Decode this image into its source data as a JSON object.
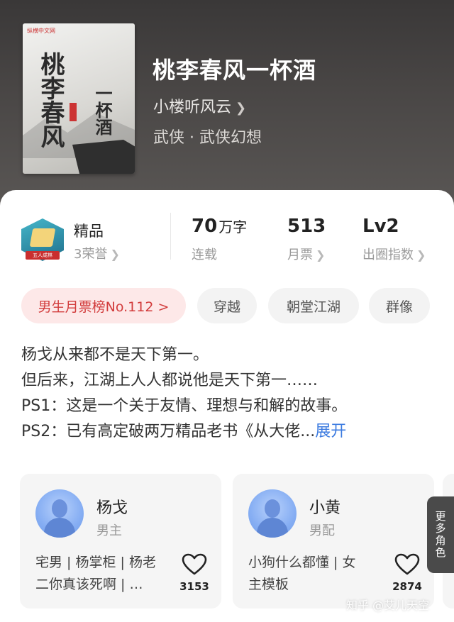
{
  "book": {
    "cover_publisher": "纵横中文网",
    "cover_title_main": "桃李春风",
    "cover_title_side": "一杯酒",
    "title": "桃李春风一杯酒",
    "author": "小楼听风云",
    "genre": "武侠 · 武侠幻想"
  },
  "stats": {
    "medal_ribbon": "五人成林",
    "quality_label": "精品",
    "honors": "3荣誉",
    "words_num": "70",
    "words_unit": "万字",
    "status": "连载",
    "monthly_tickets": "513",
    "monthly_label": "月票",
    "level": "Lv2",
    "level_label": "出圈指数"
  },
  "tags": [
    {
      "label": "男生月票榜No.112 >"
    },
    {
      "label": "穿越"
    },
    {
      "label": "朝堂江湖"
    },
    {
      "label": "群像"
    }
  ],
  "description": {
    "lines": [
      "杨戈从来都不是天下第一。",
      "但后来，江湖上人人都说他是天下第一……",
      "PS1：这是一个关于友情、理想与和解的故事。",
      "PS2：已有高定破两万精品老书《从大佬..."
    ],
    "expand_label": "展开"
  },
  "roles": [
    {
      "name": "杨戈",
      "type": "男主",
      "desc_lines": [
        "宅男 | 杨掌柜 | 杨老",
        "二你真该死啊 | …"
      ],
      "likes": "3153"
    },
    {
      "name": "小黄",
      "type": "男配",
      "desc_lines": [
        "小狗什么都懂 | 女",
        "主模板"
      ],
      "likes": "2874"
    }
  ],
  "more_roles_label": "更多角色",
  "watermark": "知乎 @艾儿天空",
  "colors": {
    "accent_blue": "#3c7be0",
    "rank_red": "#d23c3c",
    "rank_bg": "#fde8e8"
  }
}
